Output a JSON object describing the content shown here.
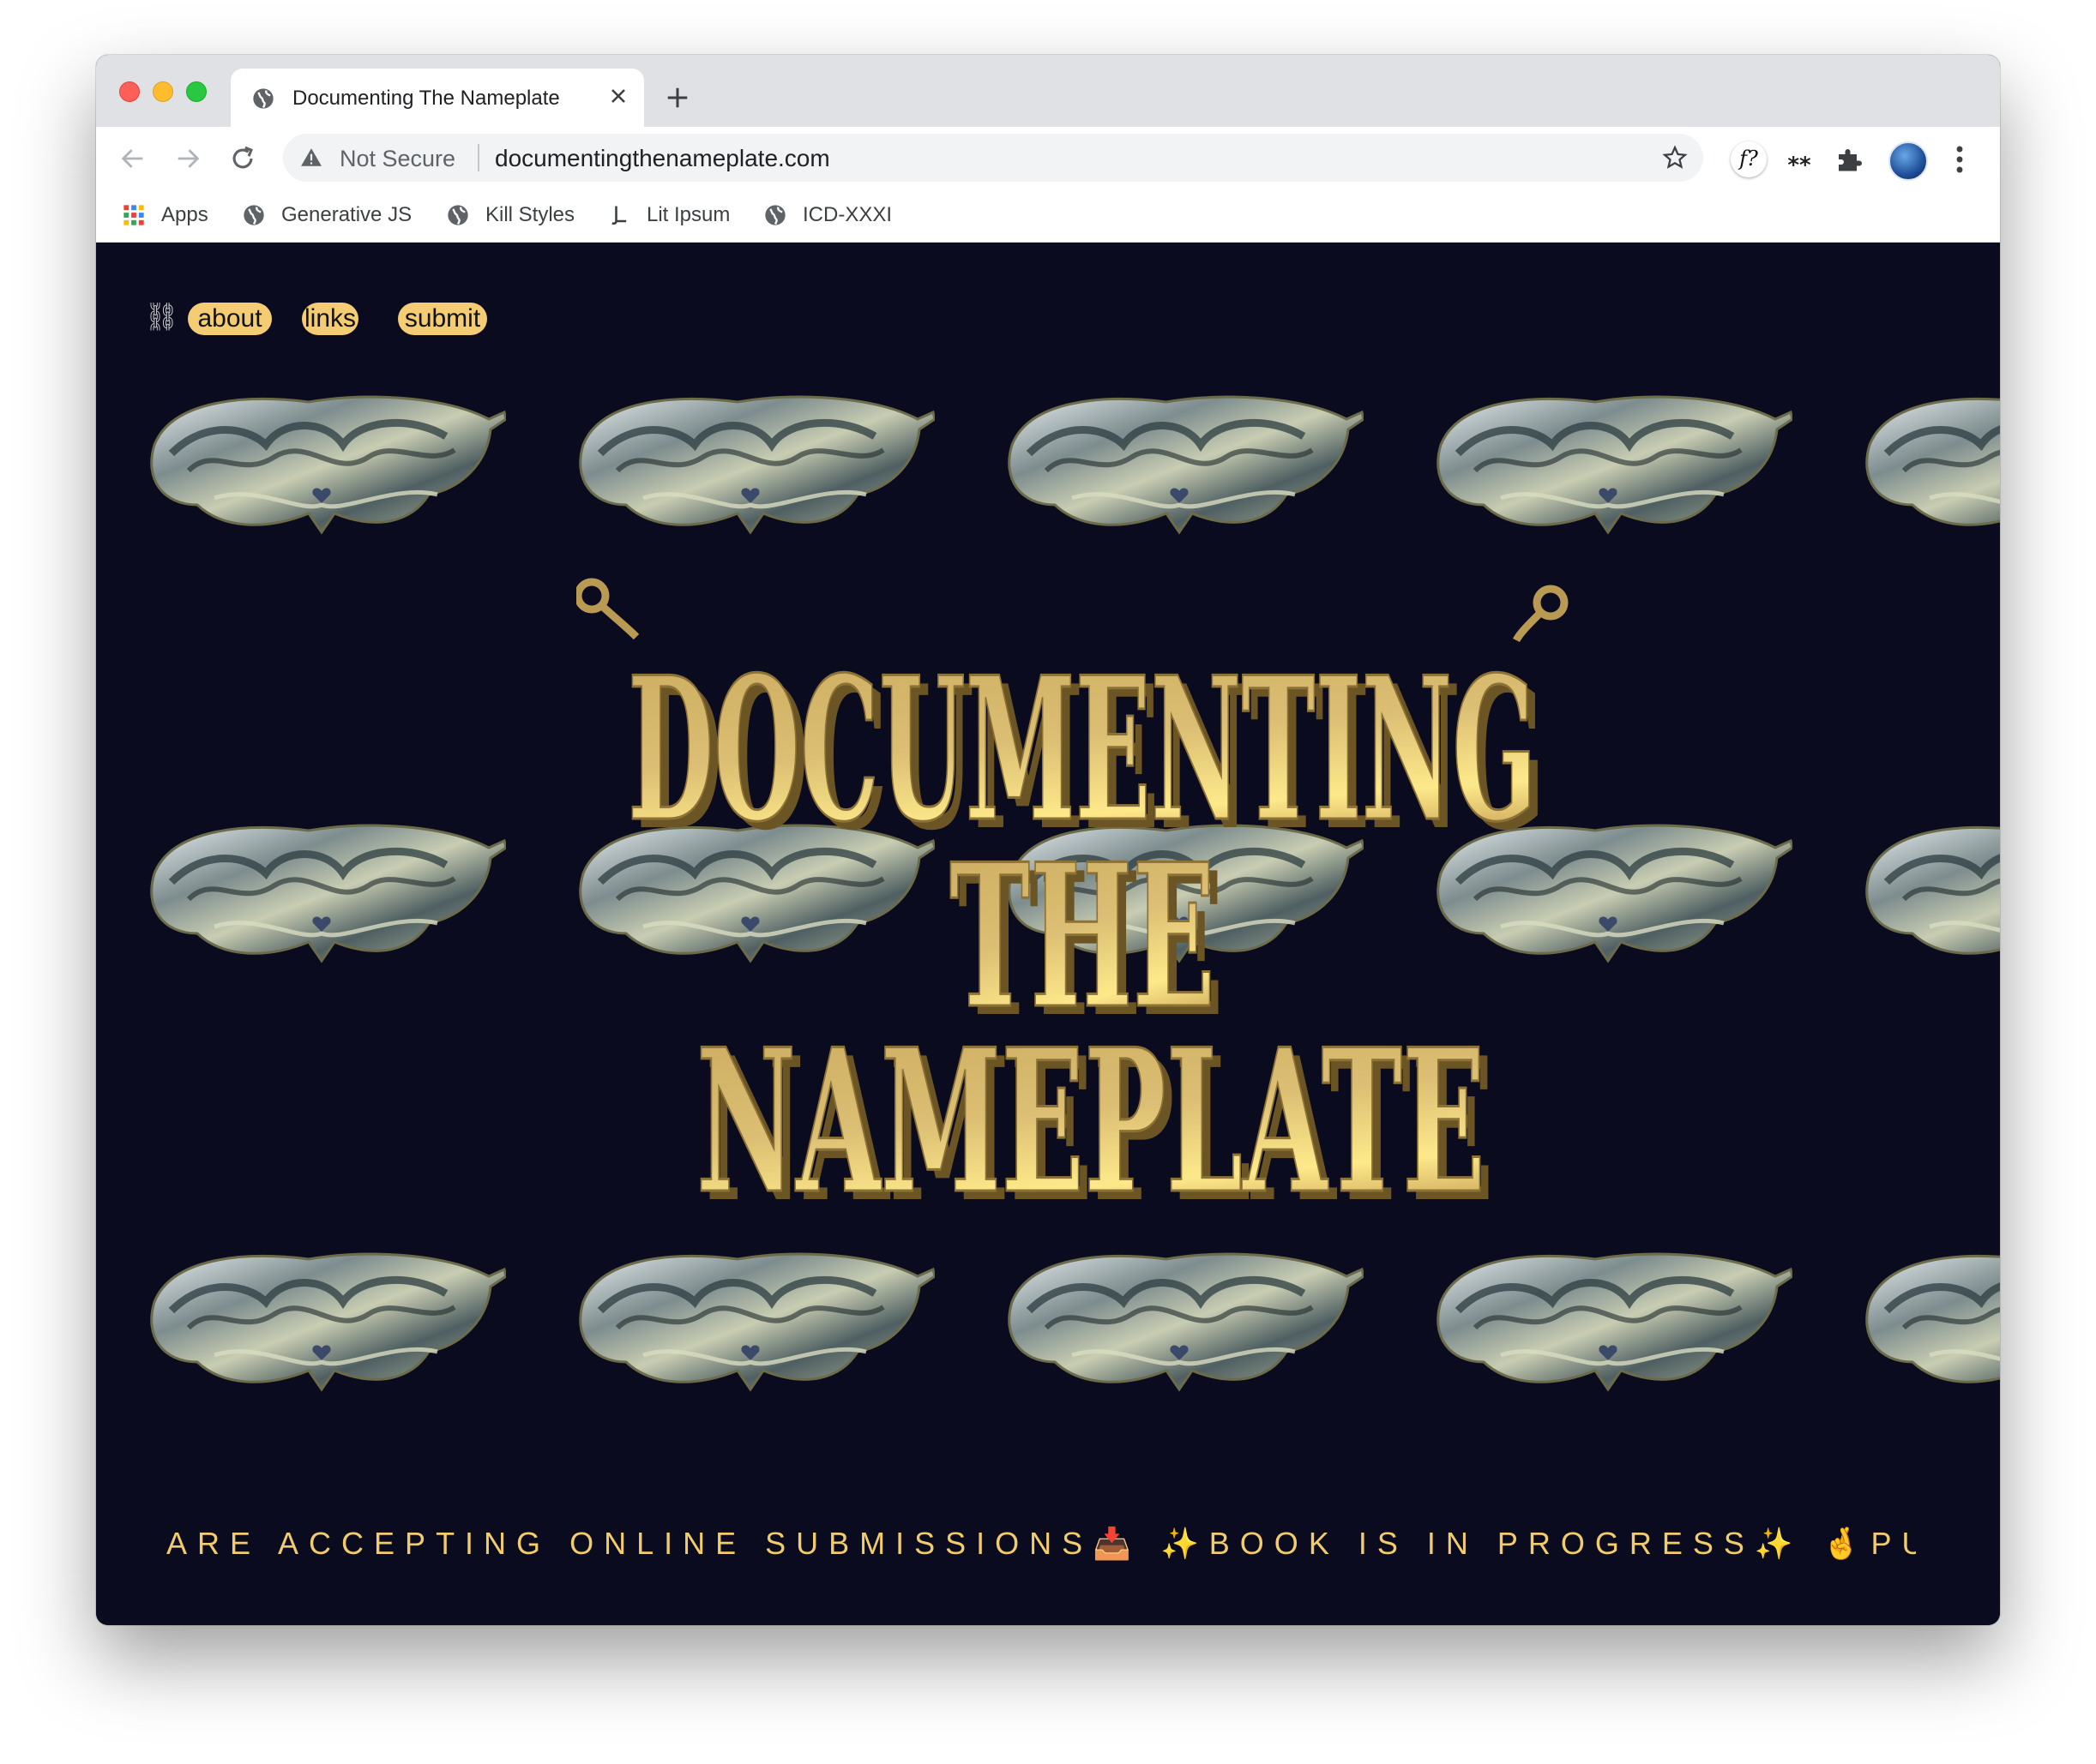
{
  "browser": {
    "tab_title": "Documenting The Nameplate",
    "security_label": "Not Secure",
    "url": "documentingthenameplate.com",
    "extension_f_label": "f?",
    "extension_stars_label": "⁎⁎",
    "bookmarks": [
      {
        "label": "Apps",
        "icon": "apps-grid-icon"
      },
      {
        "label": "Generative JS",
        "icon": "globe-icon"
      },
      {
        "label": "Kill Styles",
        "icon": "globe-icon"
      },
      {
        "label": "Lit Ipsum",
        "icon": "lit-ipsum-icon"
      },
      {
        "label": "ICD-XXXI",
        "icon": "globe-icon"
      }
    ]
  },
  "site": {
    "nav_icon": "⛓",
    "nav": {
      "about": "about",
      "links": "links",
      "submit": "submit"
    },
    "hero": {
      "line1": "DOCUMENTING",
      "line2": "THE",
      "line3": "NAMEPLATE"
    },
    "ticker": "ARE ACCEPTING ONLINE SUBMISSIONS📥 ✨BOOK IS IN PROGRESS✨ 🤞PUBLISHING IN",
    "colors": {
      "background": "#0b0b20",
      "gold": "#d9b766",
      "pill": "#f3cc74",
      "ticker": "#f2cc6c"
    }
  }
}
